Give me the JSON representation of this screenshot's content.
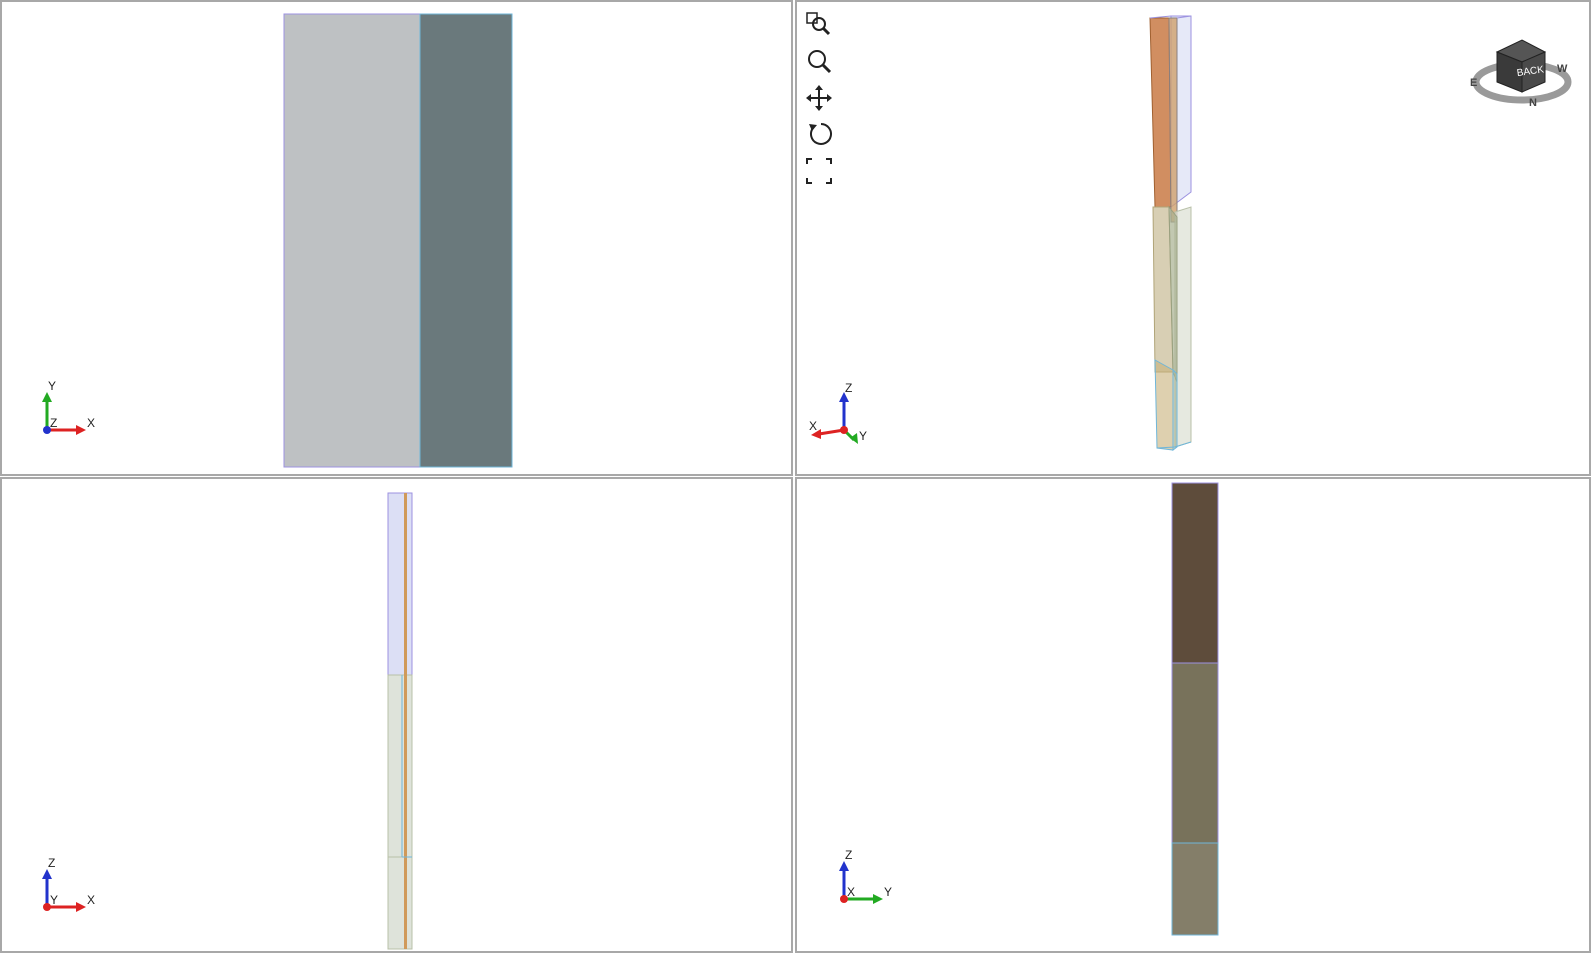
{
  "viewports": {
    "top_left": {
      "axes": {
        "up": "Y",
        "right": "X",
        "center": "Z"
      }
    },
    "top_right": {
      "axes": {
        "up": "Z",
        "left": "X",
        "right": "Y"
      },
      "toolbar": [
        "zoom-window-icon",
        "zoom-icon",
        "pan-icon",
        "rotate-icon",
        "fit-all-icon"
      ],
      "navcube": {
        "face_label": "BACK",
        "compass": [
          "E",
          "N",
          "W"
        ]
      }
    },
    "bottom_left": {
      "axes": {
        "up": "Z",
        "right": "X",
        "center": "Y"
      }
    },
    "bottom_right": {
      "axes": {
        "up": "Z",
        "right": "Y",
        "center": "X"
      }
    }
  },
  "colors": {
    "light_panel": "#bec1c3",
    "dark_panel": "#6a797c",
    "dark_brown": "#5e4c3b",
    "olive": "#78725b",
    "tan": "#847e69",
    "orange": "#c97a45",
    "edge_blue": "#6fb6d9",
    "edge_purple": "#9c92e0"
  }
}
